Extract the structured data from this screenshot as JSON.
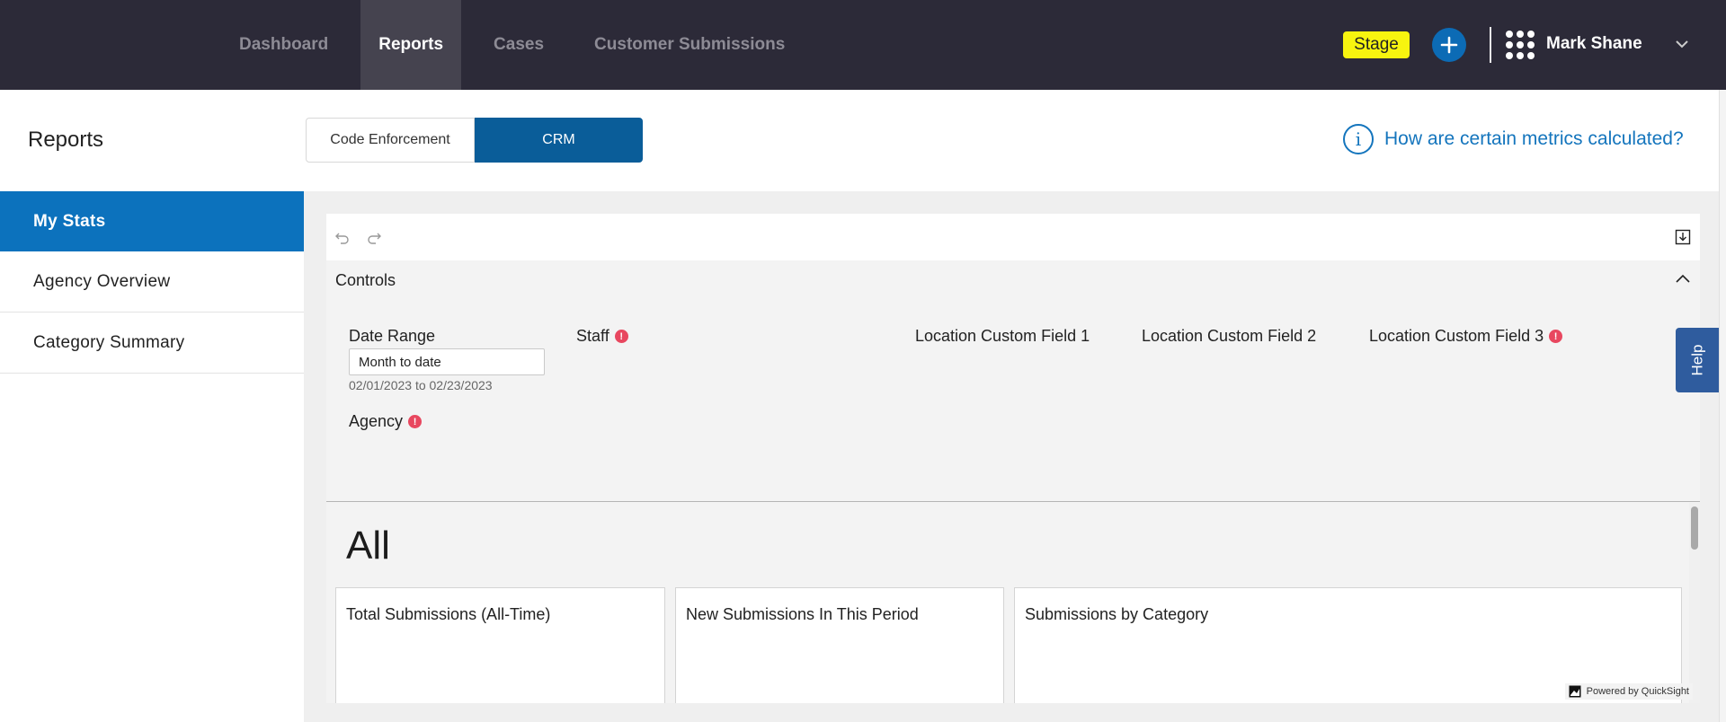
{
  "nav": {
    "items": [
      {
        "label": "Dashboard",
        "active": false
      },
      {
        "label": "Reports",
        "active": true
      },
      {
        "label": "Cases",
        "active": false
      },
      {
        "label": "Customer Submissions",
        "active": false
      }
    ],
    "stage_badge": "Stage",
    "add_icon": "plus-icon",
    "apps_icon": "apps-grid-icon",
    "user_name": "Mark Shane",
    "user_menu_icon": "chevron-down-icon"
  },
  "header": {
    "title": "Reports",
    "segments": [
      {
        "label": "Code Enforcement",
        "selected": false
      },
      {
        "label": "CRM",
        "selected": true
      }
    ],
    "metrics_link": "How are certain metrics calculated?",
    "info_icon": "info-icon"
  },
  "sidebar": {
    "items": [
      {
        "label": "My Stats",
        "active": true
      },
      {
        "label": "Agency Overview",
        "active": false
      },
      {
        "label": "Category Summary",
        "active": false
      }
    ]
  },
  "dashboard": {
    "toolbar": {
      "undo_icon": "undo-icon",
      "redo_icon": "redo-icon",
      "export_icon": "export-icon"
    },
    "controls": {
      "title": "Controls",
      "date_range": {
        "label": "Date Range",
        "value": "Month to date",
        "range_text": "02/01/2023 to 02/23/2023"
      },
      "staff": {
        "label": "Staff",
        "warning": "!"
      },
      "location_1": {
        "label": "Location Custom Field 1"
      },
      "location_2": {
        "label": "Location Custom Field 2"
      },
      "location_3": {
        "label": "Location Custom Field 3",
        "warning": "!"
      },
      "agency": {
        "label": "Agency",
        "warning": "!"
      }
    },
    "sheet_title": "All",
    "cards": [
      {
        "title": "Total Submissions (All-Time)"
      },
      {
        "title": "New Submissions In This Period"
      },
      {
        "title": "Submissions by Category"
      }
    ],
    "powered_by": "Powered by QuickSight"
  },
  "help_tab": "Help",
  "colors": {
    "topbar": "#2c2a38",
    "accent_blue": "#0c72bd",
    "segment_selected": "#0a5d99",
    "stage_yellow": "#f7f40f",
    "warning_red": "#e8475f"
  }
}
